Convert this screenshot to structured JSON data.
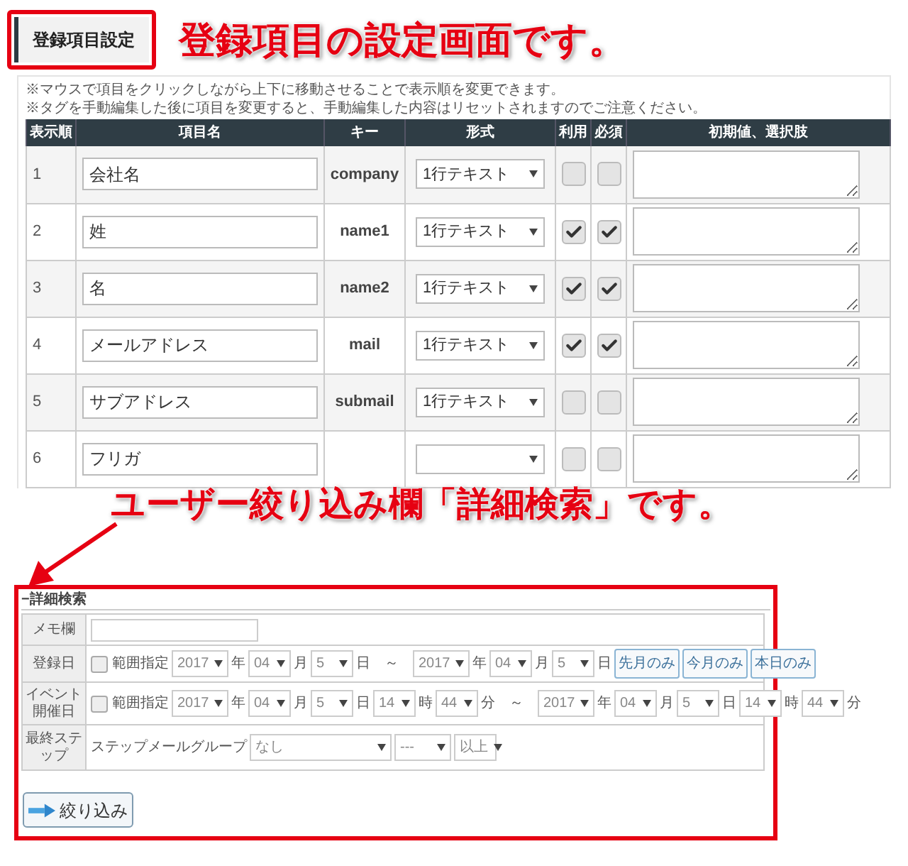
{
  "header": {
    "title": "登録項目設定",
    "callout": "登録項目の設定画面です。"
  },
  "notes": [
    "※マウスで項目をクリックしながら上下に移動させることで表示順を変更できます。",
    "※タグを手動編集した後に項目を変更すると、手動編集した内容はリセットされますのでご注意ください。"
  ],
  "table": {
    "columns": [
      "表示順",
      "項目名",
      "キー",
      "形式",
      "利用",
      "必須",
      "初期値、選択肢"
    ],
    "rows": [
      {
        "order": "1",
        "name": "会社名",
        "key": "company",
        "format": "1行テキスト",
        "use": false,
        "required": false
      },
      {
        "order": "2",
        "name": "姓",
        "key": "name1",
        "format": "1行テキスト",
        "use": true,
        "required": true
      },
      {
        "order": "3",
        "name": "名",
        "key": "name2",
        "format": "1行テキスト",
        "use": true,
        "required": true
      },
      {
        "order": "4",
        "name": "メールアドレス",
        "key": "mail",
        "format": "1行テキスト",
        "use": true,
        "required": true
      },
      {
        "order": "5",
        "name": "サブアドレス",
        "key": "submail",
        "format": "1行テキスト",
        "use": false,
        "required": false
      },
      {
        "order": "6",
        "name": "フリガ",
        "use": false,
        "required": false
      }
    ]
  },
  "callout2": "ユーザー絞り込み欄「詳細検索」です。",
  "search": {
    "toggle": "−",
    "title": "詳細検索",
    "rows": [
      {
        "label": "メモ欄",
        "items": [
          {
            "kind": "input"
          }
        ]
      },
      {
        "label": "登録日",
        "items": [
          {
            "kind": "check",
            "label": "範囲指定",
            "checked": false
          },
          {
            "kind": "select",
            "value": "2017"
          },
          {
            "kind": "unit",
            "text": "年"
          },
          {
            "kind": "select",
            "value": "04"
          },
          {
            "kind": "unit",
            "text": "月"
          },
          {
            "kind": "select",
            "value": "5"
          },
          {
            "kind": "unit",
            "text": "日"
          },
          {
            "kind": "sep",
            "text": "～"
          },
          {
            "kind": "select",
            "value": "2017"
          },
          {
            "kind": "unit",
            "text": "年"
          },
          {
            "kind": "select",
            "value": "04"
          },
          {
            "kind": "unit",
            "text": "月"
          },
          {
            "kind": "select",
            "value": "5"
          },
          {
            "kind": "unit",
            "text": "日"
          },
          {
            "kind": "button",
            "text": "先月のみ"
          },
          {
            "kind": "button",
            "text": "今月のみ"
          },
          {
            "kind": "button",
            "text": "本日のみ"
          }
        ]
      },
      {
        "label": "イベント開催日",
        "items": [
          {
            "kind": "check",
            "label": "範囲指定",
            "checked": false
          },
          {
            "kind": "select",
            "value": "2017"
          },
          {
            "kind": "unit",
            "text": "年"
          },
          {
            "kind": "select",
            "value": "04"
          },
          {
            "kind": "unit",
            "text": "月"
          },
          {
            "kind": "select",
            "value": "5"
          },
          {
            "kind": "unit",
            "text": "日"
          },
          {
            "kind": "select",
            "value": "14"
          },
          {
            "kind": "unit",
            "text": "時"
          },
          {
            "kind": "select",
            "value": "44"
          },
          {
            "kind": "unit",
            "text": "分"
          },
          {
            "kind": "sep",
            "text": "～"
          },
          {
            "kind": "select",
            "value": "2017"
          },
          {
            "kind": "unit",
            "text": "年"
          },
          {
            "kind": "select",
            "value": "04"
          },
          {
            "kind": "unit",
            "text": "月"
          },
          {
            "kind": "select",
            "value": "5"
          },
          {
            "kind": "unit",
            "text": "日"
          },
          {
            "kind": "select",
            "value": "14"
          },
          {
            "kind": "unit",
            "text": "時"
          },
          {
            "kind": "select",
            "value": "44"
          },
          {
            "kind": "unit",
            "text": "分"
          }
        ]
      },
      {
        "label": "最終ステップ",
        "items": [
          {
            "kind": "unit",
            "text": "ステップメールグループ"
          },
          {
            "kind": "select-wide",
            "value": "なし"
          },
          {
            "kind": "select",
            "value": "---"
          },
          {
            "kind": "select",
            "value": "以上"
          }
        ]
      }
    ],
    "submit": "絞り込み"
  }
}
